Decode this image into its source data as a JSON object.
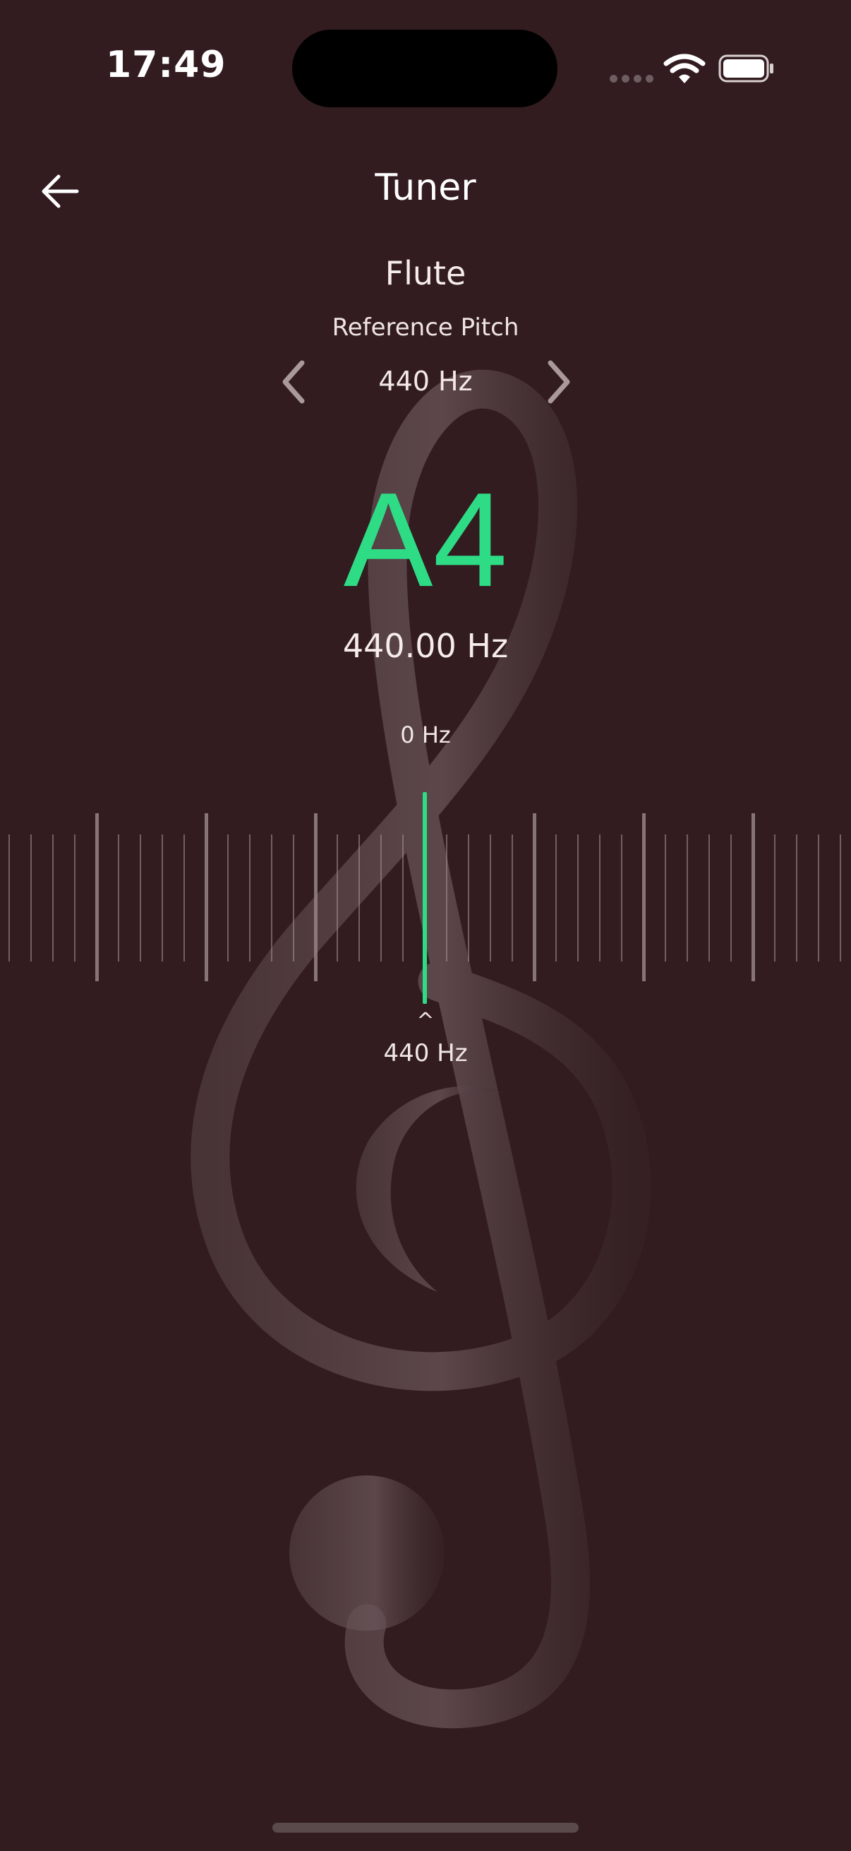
{
  "status_bar": {
    "time": "17:49"
  },
  "header": {
    "title": "Tuner",
    "back_icon": "arrow-left-icon"
  },
  "instrument": "Flute",
  "reference_pitch": {
    "label": "Reference Pitch",
    "value": "440 Hz",
    "prev_icon": "chevron-left-icon",
    "next_icon": "chevron-right-icon"
  },
  "reading": {
    "note": "A4",
    "frequency": "440.00 Hz",
    "offset": "0 Hz",
    "caret": "^",
    "target": "440 Hz",
    "needle_position": 0
  },
  "colors": {
    "background": "#321c1f",
    "accent": "#2fdc86",
    "text": "#f3eaea"
  }
}
